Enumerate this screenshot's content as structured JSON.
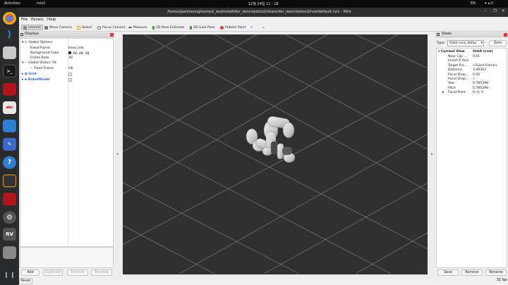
{
  "system": {
    "activities": "Activities",
    "app_name": "rviz2",
    "clock": "12월 24일  11 : 18",
    "lang": "EN"
  },
  "window": {
    "title": "/home/parkseongho/ros2_ws/install/dsr_description2/share/dsr_description2/rviz/default.rviz - RViz"
  },
  "menu": {
    "file": "File",
    "panels": "Panels",
    "help": "Help"
  },
  "toolbar": {
    "interact": "Interact",
    "move_camera": "Move Camera",
    "select": "Select",
    "focus_camera": "Focus Camera",
    "measure": "Measure",
    "pose_estimate": "2D Pose Estimate",
    "goal_pose": "2D Goal Pose",
    "publish_point": "Publish Point",
    "plus": "✛",
    "minus": "▬"
  },
  "displays": {
    "title": "Displays",
    "global_options": "Global Options",
    "fixed_frame_label": "Fixed Frame",
    "fixed_frame_value": "base_link",
    "bg_color_label": "Background Color",
    "bg_color_value": "48; 48; 48",
    "frame_rate_label": "Frame Rate",
    "frame_rate_value": "30",
    "global_status": "Global Status: Ok",
    "status_fixed_frame_label": "Fixed Frame",
    "status_fixed_frame_value": "OK",
    "grid": "Grid",
    "robot_model": "RobotModel",
    "check": "✓",
    "buttons": {
      "add": "Add",
      "duplicate": "Duplicate",
      "remove": "Remove",
      "rename": "Rename"
    }
  },
  "views": {
    "title": "Views",
    "type_label": "Type:",
    "type_value": "Orbit (rviz_defau",
    "zero": "Zero",
    "current_view": "Current View",
    "current_view_value": "Orbit (rviz)",
    "rows": [
      {
        "label": "Near Clip ...",
        "value": "0.01"
      },
      {
        "label": "Invert Z Axis",
        "value": ""
      },
      {
        "label": "Target Fra...",
        "value": "<Fixed Frame>"
      },
      {
        "label": "Distance",
        "value": "3.49352"
      },
      {
        "label": "Focal Shap...",
        "value": "0.05"
      },
      {
        "label": "Focal Shap...",
        "value": "✓"
      },
      {
        "label": "Yaw",
        "value": "0.785398"
      },
      {
        "label": "Pitch",
        "value": "0.785398"
      },
      {
        "label": "Focal Point",
        "value": "0; 0; 0"
      }
    ],
    "buttons": {
      "save": "Save",
      "remove": "Remove",
      "rename": "Rename"
    }
  },
  "status": {
    "reset": "Reset",
    "fps": "31 fps"
  },
  "colors": {
    "viewport_bg": "#303030",
    "accent": "#3c6ee0"
  }
}
